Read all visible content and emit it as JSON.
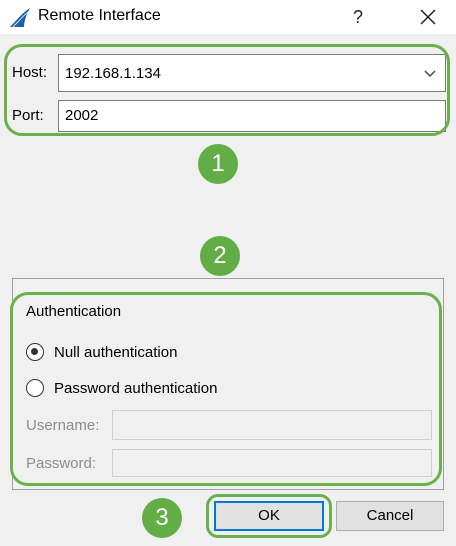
{
  "window": {
    "title": "Remote Interface",
    "help_symbol": "?",
    "icon": "wireshark-fin-icon"
  },
  "connection": {
    "host_label": "Host:",
    "host_value": "192.168.1.134",
    "port_label": "Port:",
    "port_value": "2002"
  },
  "authentication": {
    "group_title": "Authentication",
    "null_auth_label": "Null authentication",
    "password_auth_label": "Password authentication",
    "selected": "Null authentication",
    "username_label": "Username:",
    "password_label": "Password:",
    "username_value": "",
    "password_value": ""
  },
  "buttons": {
    "ok_label": "OK",
    "cancel_label": "Cancel"
  },
  "annotations": {
    "badge_1": "1",
    "badge_2": "2",
    "badge_3": "3"
  },
  "colors": {
    "highlight_green": "#6ab04c",
    "badge_green": "#62ad46",
    "focus_blue": "#0078d7",
    "icon_blue": "#1d5fa8"
  }
}
